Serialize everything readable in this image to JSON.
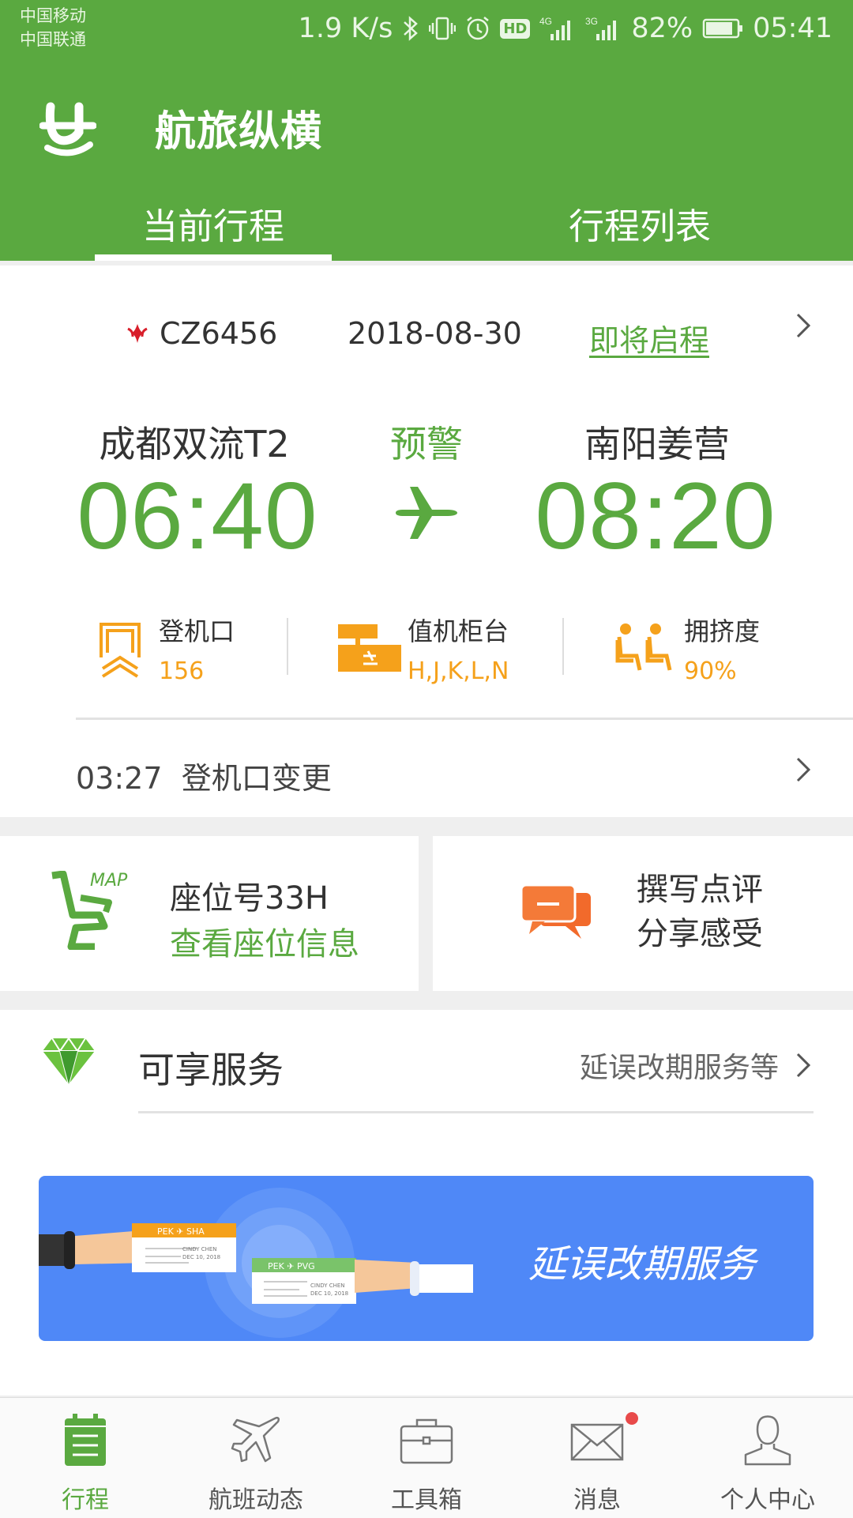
{
  "status_bar": {
    "carrier1": "中国移动",
    "carrier2": "中国联通",
    "speed": "1.9 K/s",
    "hd": "HD",
    "net1": "4G",
    "net2": "3G",
    "battery": "82%",
    "time": "05:41"
  },
  "header": {
    "brand": "航旅纵横",
    "tabs": [
      {
        "label": "当前行程",
        "active": true
      },
      {
        "label": "行程列表",
        "active": false
      }
    ]
  },
  "trip": {
    "flight_no": "CZ6456",
    "date": "2018-08-30",
    "status": "即将启程",
    "departure_city": "成都双流T2",
    "departure_time": "06:40",
    "warning": "预警",
    "arrival_city": "南阳姜营",
    "arrival_time": "08:20",
    "gate_label": "登机口",
    "gate_value": "156",
    "counter_label": "值机柜台",
    "counter_value": "H,J,K,L,N",
    "crowd_label": "拥挤度",
    "crowd_value": "90%",
    "notice_time": "03:27",
    "notice_text": "登机口变更"
  },
  "seat": {
    "map_tag": "MAP",
    "title": "座位号33H",
    "link": "查看座位信息"
  },
  "review": {
    "line1": "撰写点评",
    "line2": "分享感受"
  },
  "services": {
    "title": "可享服务",
    "more": "延误改期服务等",
    "banner_text": "延误改期服务",
    "ticket1_from": "PEK",
    "ticket1_to": "SHA",
    "ticket2_from": "PEK",
    "ticket2_to": "PVG",
    "passenger": "CINDY CHEN",
    "ticket_date": "DEC 10, 2018"
  },
  "nav": {
    "items": [
      {
        "label": "行程",
        "active": true
      },
      {
        "label": "航班动态",
        "active": false
      },
      {
        "label": "工具箱",
        "active": false
      },
      {
        "label": "消息",
        "active": false
      },
      {
        "label": "个人中心",
        "active": false
      }
    ]
  },
  "colors": {
    "brand_green": "#5aa940",
    "accent_orange": "#f5a11b",
    "banner_blue": "#4f88f7",
    "review_orange": "#f26a2b",
    "badge_red": "#e84a4a"
  }
}
